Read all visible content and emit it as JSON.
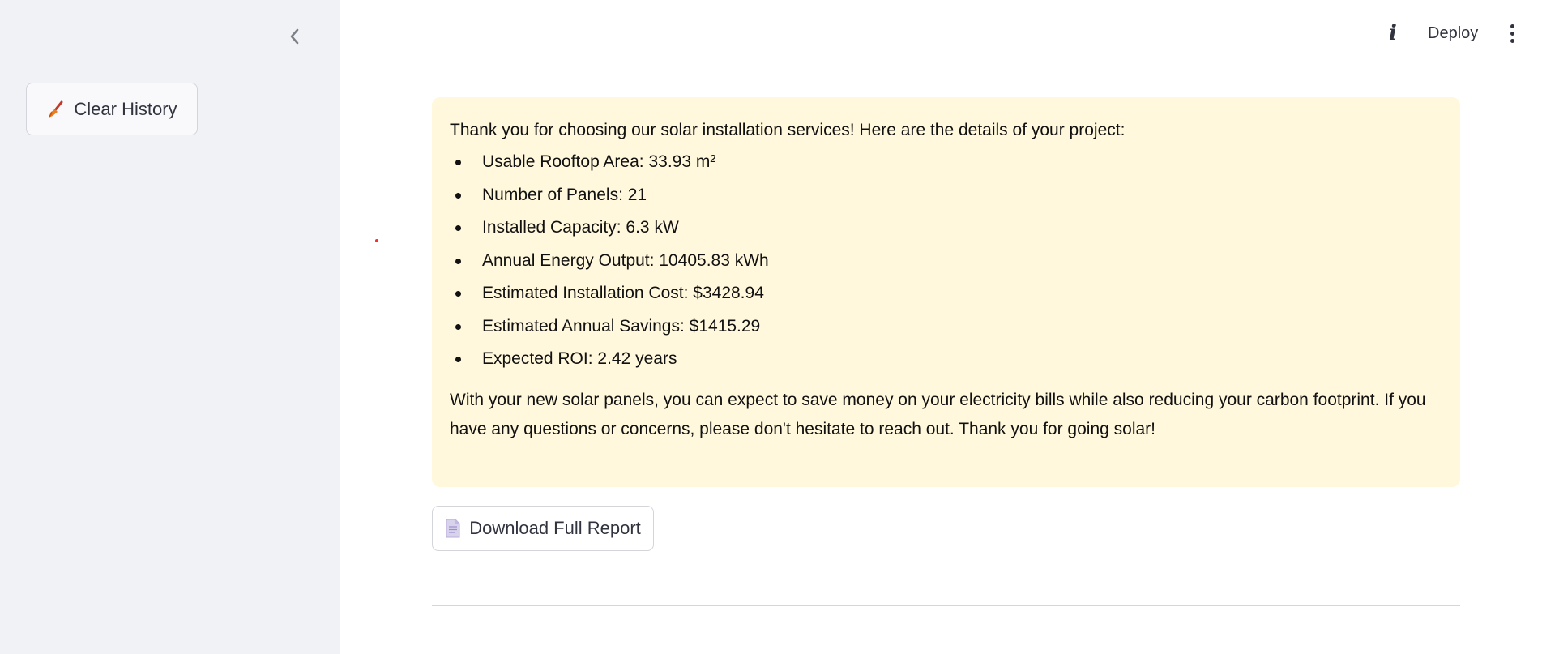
{
  "sidebar": {
    "collapse_icon": "chevron-left-icon",
    "clear_history": {
      "icon": "broom-icon",
      "label": "Clear History"
    }
  },
  "header": {
    "info_icon": "info-icon",
    "info_glyph": "i",
    "deploy_label": "Deploy",
    "menu_icon": "kebab-menu-icon"
  },
  "message": {
    "intro": "Thank you for choosing our solar installation services! Here are the details of your project:",
    "items": [
      "Usable Rooftop Area: 33.93 m²",
      "Number of Panels: 21",
      "Installed Capacity: 6.3 kW",
      "Annual Energy Output: 10405.83 kWh",
      "Estimated Installation Cost: $3428.94",
      "Estimated Annual Savings: $1415.29",
      "Expected ROI: 2.42 years"
    ],
    "outro": "With your new solar panels, you can expect to save money on your electricity bills while also reducing your carbon footprint. If you have any questions or concerns, please don't hesitate to reach out. Thank you for going solar!",
    "background_color": "#fff8dc"
  },
  "download": {
    "icon": "document-icon",
    "label": "Download Full Report"
  },
  "colors": {
    "sidebar_bg": "#f0f2f6",
    "text": "#31333f",
    "accent_dot": "#ff2b2b"
  }
}
